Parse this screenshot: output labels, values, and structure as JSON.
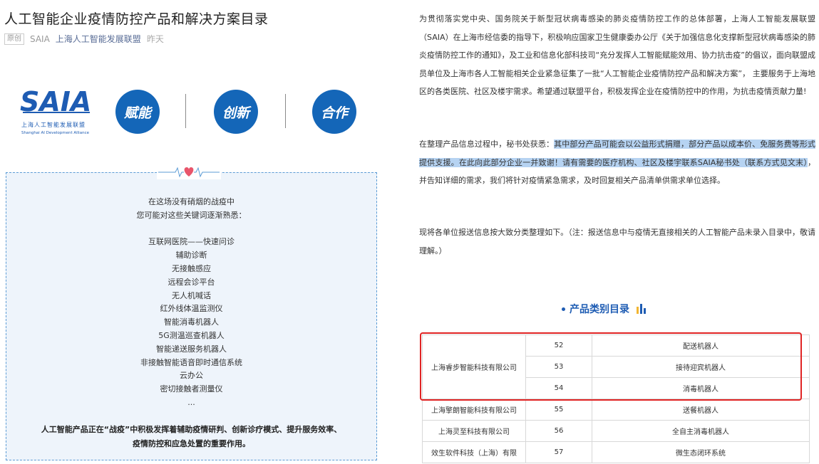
{
  "article": {
    "title": "人工智能企业疫情防控产品和解决方案目录",
    "original_tag": "原创",
    "account": "SAIA",
    "author": "上海人工智能发展联盟",
    "date": "昨天"
  },
  "banner": {
    "logo_text": "SAIA",
    "logo_cn": "上海人工智能发展联盟",
    "logo_en": "Shanghai AI Development Alliance",
    "circles": [
      "赋能",
      "创新",
      "合作"
    ]
  },
  "keywords_box": {
    "intro": [
      "在这场没有硝烟的战疫中",
      "您可能对这些关键词逐渐熟悉："
    ],
    "keywords": [
      "互联网医院——快速问诊",
      "辅助诊断",
      "无接触感应",
      "远程会诊平台",
      "无人机喊话",
      "红外线体温监测仪",
      "智能消毒机器人",
      "5G测温巡查机器人",
      "智能递送服务机器人",
      "非接触智能语音即时通信系统",
      "云办公",
      "密切接触者测量仪",
      "..."
    ],
    "conclusion": [
      "人工智能产品正在“战疫”中积极发挥着辅助疫情研判、创新诊疗模式、提升服务效率、",
      "疫情防控和应急处置的重要作用。"
    ]
  },
  "right": {
    "para1": "为贯彻落实党中央、国务院关于新型冠状病毒感染的肺炎疫情防控工作的总体部署，上海人工智能发展联盟（SAIA）在上海市经信委的指导下，积极响应国家卫生健康委办公厅《关于加强信息化支撑新型冠状病毒感染的肺炎疫情防控工作的通知》，及工业和信息化部科技司“充分发挥人工智能赋能效用、协力抗击疫”的倡议，面向联盟成员单位及上海市各人工智能相关企业紧急征集了一批“人工智能企业疫情防控产品和解决方案”， 主要服务于上海地区的各类医院、社区及楼宇需求。希望通过联盟平台，积极发挥企业在疫情防控中的作用，为抗击疫情贡献力量!",
    "para2_prefix": "在整理产品信息过程中，秘书处获悉：",
    "para2_highlight": "其中部分产品可能会以公益形式捐赠，部分产品以成本价、免服务费等形式提供支援。在此向此部分企业一并致谢！请有需要的医疗机构、社区及楼宇联系SAIA秘书处（联系方式见文末）",
    "para2_suffix": "，并告知详细的需求，我们将针对疫情紧急需求，及时回复相关产品清单供需求单位选择。",
    "para3": "现将各单位报送信息按大致分类整理如下。（注：报送信息中与疫情无直接相关的人工智能产品未录入目录中，敬请理解。）",
    "section_title": "产品类别目录",
    "table": [
      {
        "company": "上海睿步智能科技有限公司",
        "no": "52",
        "product": "配送机器人"
      },
      {
        "company": "",
        "no": "53",
        "product": "接待迎宾机器人"
      },
      {
        "company": "",
        "no": "54",
        "product": "消毒机器人"
      },
      {
        "company": "上海擎朗智能科技有限公司",
        "no": "55",
        "product": "送餐机器人"
      },
      {
        "company": "上海灵至科技有限公司",
        "no": "56",
        "product": "全自主消毒机器人"
      },
      {
        "company": "效生软件科技（上海）有限",
        "no": "57",
        "product": "微生态闭环系统"
      }
    ]
  },
  "colors": {
    "accent": "#1466b8",
    "highlight": "#b6d3f2",
    "red_box": "#e02424"
  }
}
